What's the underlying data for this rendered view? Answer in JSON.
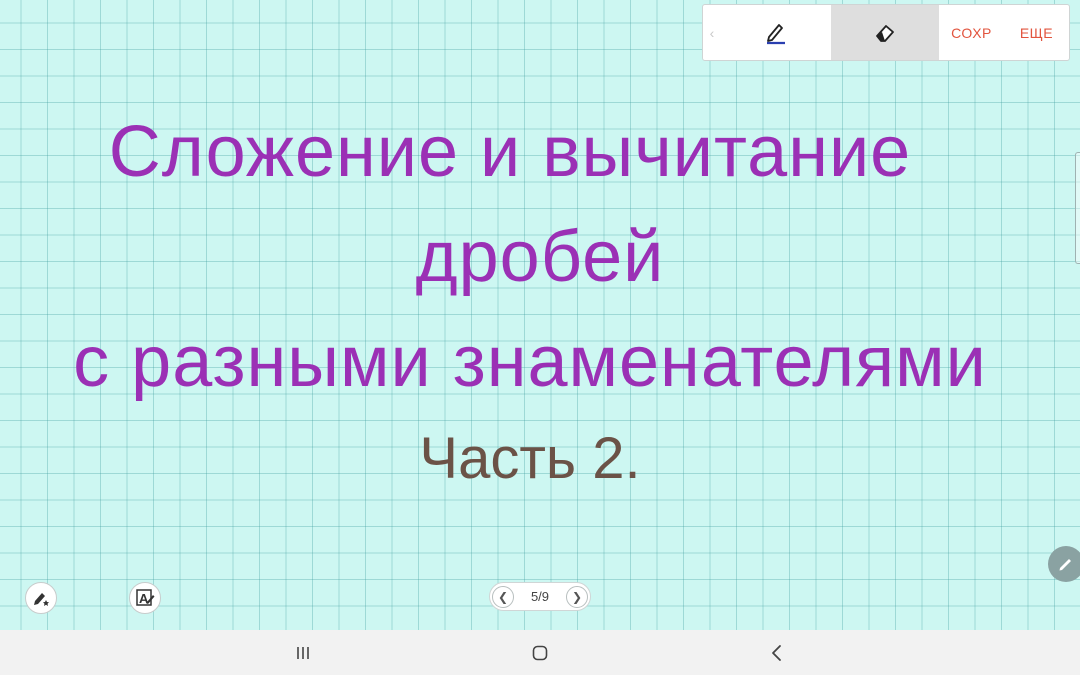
{
  "board": {
    "title_lines": [
      "Сложение и вычитание",
      "дробей",
      "с разными знаменателями"
    ],
    "subtitle": "Часть 2.",
    "title_color": "#9b30b5",
    "subtitle_color": "#6b5247",
    "background_color": "#cdf7f2"
  },
  "toolbar": {
    "collapse_icon": "chevron-left-icon",
    "pen_icon": "pen-icon",
    "eraser_icon": "eraser-icon",
    "save_label": "СОХР",
    "more_label": "ЕЩЕ",
    "accent_color": "#e2543e"
  },
  "pager": {
    "current": "5/9",
    "prev_icon": "chevron-left-icon",
    "next_icon": "chevron-right-icon"
  },
  "bottom_tools": {
    "left_icon": "pen-star-icon",
    "right_icon": "text-recognition-icon"
  },
  "side": {
    "fab_icon": "pencil-icon"
  },
  "system_nav": {
    "recents_icon": "recents-icon",
    "home_icon": "home-icon",
    "back_icon": "back-icon"
  }
}
